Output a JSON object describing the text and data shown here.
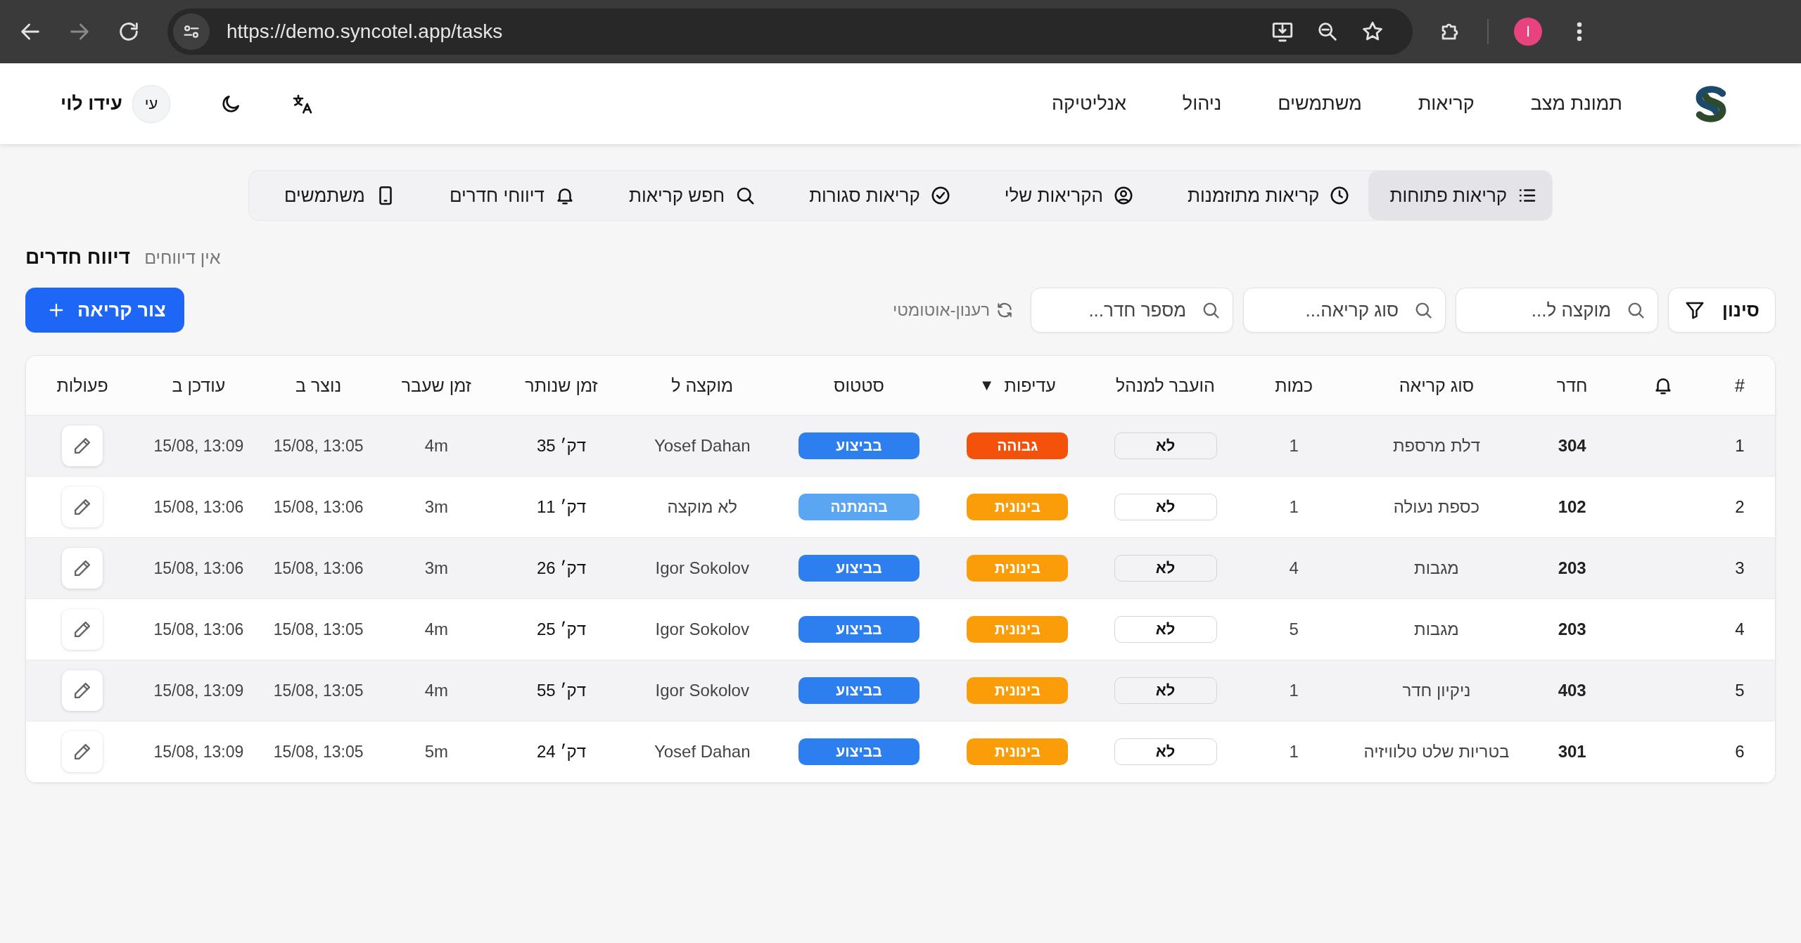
{
  "browser": {
    "url": "https://demo.syncotel.app/tasks",
    "profile_initial": "I"
  },
  "header": {
    "nav": [
      {
        "label": "תמונת מצב"
      },
      {
        "label": "קריאות"
      },
      {
        "label": "משתמשים"
      },
      {
        "label": "ניהול"
      },
      {
        "label": "אנליטיקה"
      }
    ],
    "user": {
      "name": "עידו לוי",
      "initials": "עי"
    }
  },
  "tabs": [
    {
      "label": "קריאות פתוחות",
      "selected": true
    },
    {
      "label": "קריאות מתוזמנות",
      "selected": false
    },
    {
      "label": "הקריאות שלי",
      "selected": false
    },
    {
      "label": "קריאות סגורות",
      "selected": false
    },
    {
      "label": "חפש קריאות",
      "selected": false
    },
    {
      "label": "דיווחי חדרים",
      "selected": false
    },
    {
      "label": "משתמשים",
      "selected": false
    }
  ],
  "page": {
    "subtitle": "אין דיווחים",
    "title": "דיווח חדרים"
  },
  "filters": {
    "filter_button": "סינון",
    "searches": [
      {
        "placeholder": "מוקצה ל..."
      },
      {
        "placeholder": "סוג קריאה..."
      },
      {
        "placeholder": "מספר חדר..."
      }
    ],
    "auto_refresh": "רענון-אוטומטי",
    "create_button": "צור קריאה"
  },
  "table": {
    "columns": [
      {
        "kind": "text",
        "label": "#"
      },
      {
        "kind": "icon"
      },
      {
        "kind": "text",
        "label": "חדר"
      },
      {
        "kind": "text",
        "label": "סוג קריאה"
      },
      {
        "kind": "text",
        "label": "כמות"
      },
      {
        "kind": "text",
        "label": "הועבר למנהל"
      },
      {
        "kind": "text",
        "label": "עדיפות",
        "sort_mark": "▼"
      },
      {
        "kind": "text",
        "label": "סטטוס"
      },
      {
        "kind": "text",
        "label": "מוקצה ל"
      },
      {
        "kind": "text",
        "label": "זמן שנותר"
      },
      {
        "kind": "text",
        "label": "זמן שעבר"
      },
      {
        "kind": "text",
        "label": "נוצר ב"
      },
      {
        "kind": "text",
        "label": "עודכן ב"
      },
      {
        "kind": "text",
        "label": "פעולות"
      }
    ],
    "rows": [
      {
        "number": "1",
        "room": "304",
        "type": "דלת מרספת",
        "quantity": "1",
        "escalated": "לא",
        "priority": {
          "label": "גבוהה",
          "color": "#f4510b"
        },
        "status": {
          "label": "בביצוע",
          "color": "#2d7ff0"
        },
        "assignee": "Yosef Dahan",
        "remaining": "דק׳ 35",
        "elapsed": "4m",
        "created": "15/08, 13:05",
        "updated": "15/08, 13:09"
      },
      {
        "number": "2",
        "room": "102",
        "type": "כספת נעולה",
        "quantity": "1",
        "escalated": "לא",
        "priority": {
          "label": "בינונית",
          "color": "#fb9d09"
        },
        "status": {
          "label": "בהמתנה",
          "color": "#5ba6f3"
        },
        "assignee": "לא מוקצה",
        "remaining": "דק׳ 11",
        "elapsed": "3m",
        "created": "15/08, 13:06",
        "updated": "15/08, 13:06"
      },
      {
        "number": "3",
        "room": "203",
        "type": "מגבות",
        "quantity": "4",
        "escalated": "לא",
        "priority": {
          "label": "בינונית",
          "color": "#fb9d09"
        },
        "status": {
          "label": "בביצוע",
          "color": "#2d7ff0"
        },
        "assignee": "Igor Sokolov",
        "remaining": "דק׳ 26",
        "elapsed": "3m",
        "created": "15/08, 13:06",
        "updated": "15/08, 13:06"
      },
      {
        "number": "4",
        "room": "203",
        "type": "מגבות",
        "quantity": "5",
        "escalated": "לא",
        "priority": {
          "label": "בינונית",
          "color": "#fb9d09"
        },
        "status": {
          "label": "בביצוע",
          "color": "#2d7ff0"
        },
        "assignee": "Igor Sokolov",
        "remaining": "דק׳ 25",
        "elapsed": "4m",
        "created": "15/08, 13:05",
        "updated": "15/08, 13:06"
      },
      {
        "number": "5",
        "room": "403",
        "type": "ניקיון חדר",
        "quantity": "1",
        "escalated": "לא",
        "priority": {
          "label": "בינונית",
          "color": "#fb9d09"
        },
        "status": {
          "label": "בביצוע",
          "color": "#2d7ff0"
        },
        "assignee": "Igor Sokolov",
        "remaining": "דק׳ 55",
        "elapsed": "4m",
        "created": "15/08, 13:05",
        "updated": "15/08, 13:09"
      },
      {
        "number": "6",
        "room": "301",
        "type": "בטריות שלט טלוויזיה",
        "quantity": "1",
        "escalated": "לא",
        "priority": {
          "label": "בינונית",
          "color": "#fb9d09"
        },
        "status": {
          "label": "בביצוע",
          "color": "#2d7ff0"
        },
        "assignee": "Yosef Dahan",
        "remaining": "דק׳ 24",
        "elapsed": "5m",
        "created": "15/08, 13:05",
        "updated": "15/08, 13:09"
      }
    ]
  }
}
